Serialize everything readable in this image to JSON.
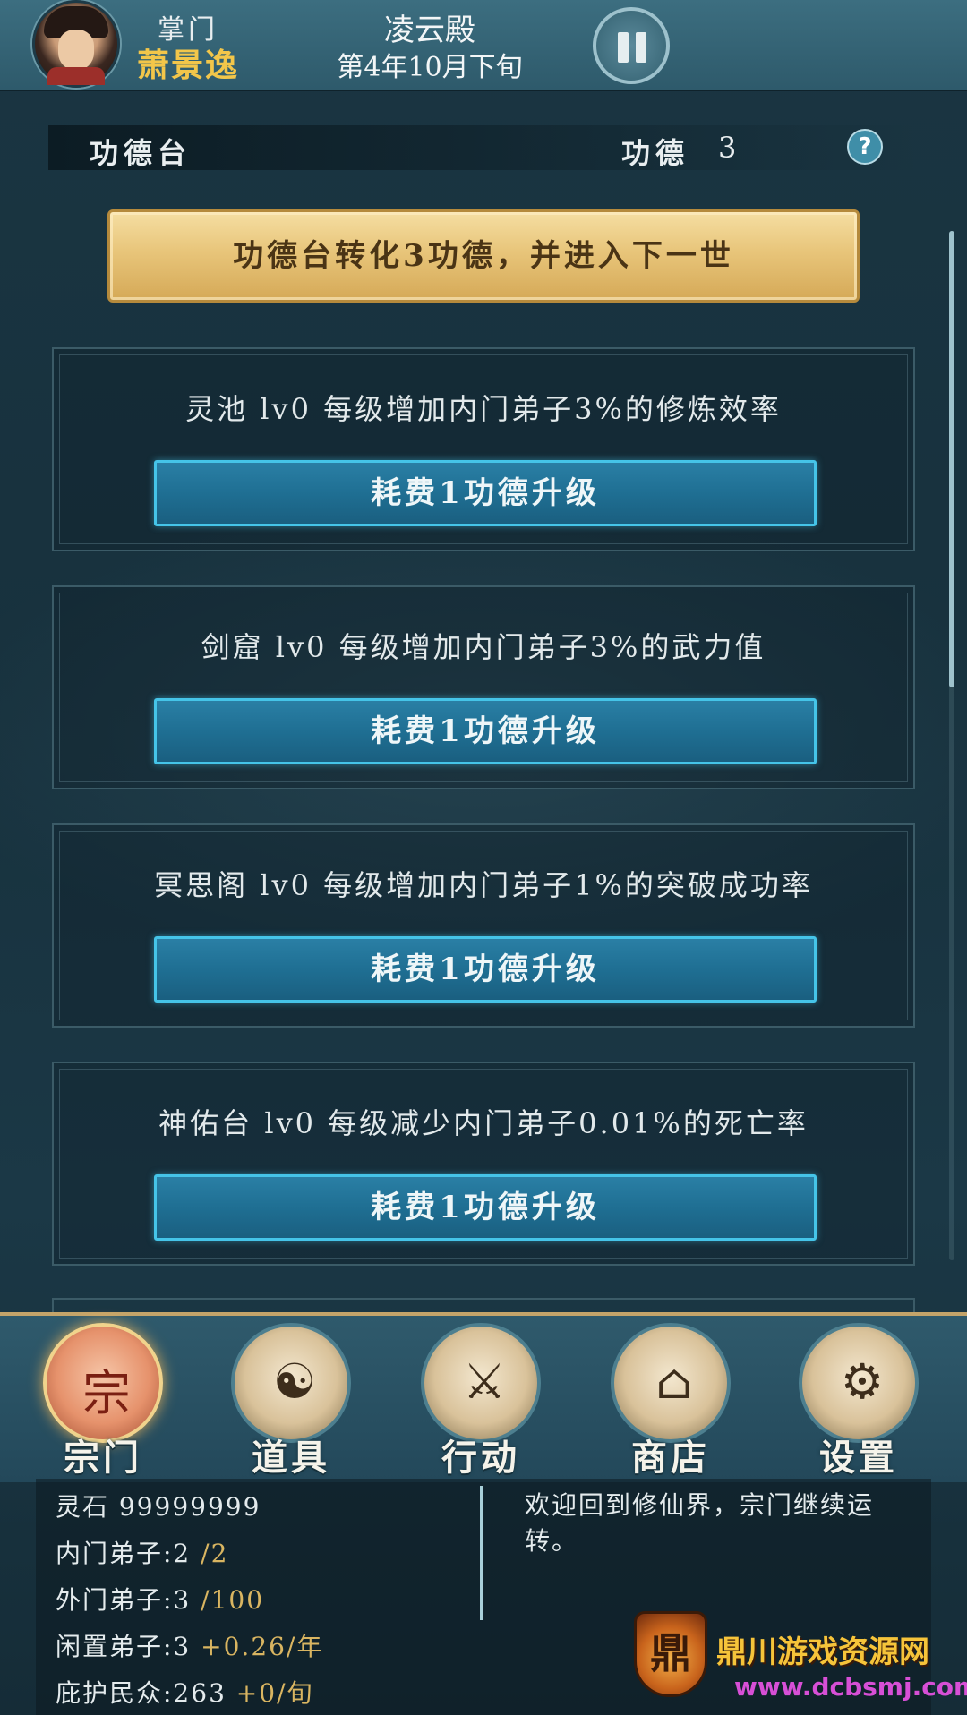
{
  "top_bar": {
    "leader_role": "掌门",
    "leader_name": "萧景逸",
    "sect_name": "凌云殿",
    "date": "第4年10月下旬"
  },
  "header": {
    "title": "功德台",
    "merit_label": "功德",
    "merit_value": "3",
    "help_symbol": "?"
  },
  "convert_button": "功德台转化3功德，并进入下一世",
  "upgrades": [
    {
      "description": "灵池 lv0 每级增加内门弟子3%的修炼效率",
      "button": "耗费1功德升级"
    },
    {
      "description": "剑窟 lv0 每级增加内门弟子3%的武力值",
      "button": "耗费1功德升级"
    },
    {
      "description": "冥思阁 lv0 每级增加内门弟子1%的突破成功率",
      "button": "耗费1功德升级"
    },
    {
      "description": "神佑台 lv0 每级减少内门弟子0.01%的死亡率",
      "button": "耗费1功德升级"
    }
  ],
  "nav": [
    {
      "label": "宗门",
      "icon": "sect-gate-icon",
      "glyph": "宗",
      "active": true
    },
    {
      "label": "道具",
      "icon": "item-bag-icon",
      "glyph": "☯",
      "active": false
    },
    {
      "label": "行动",
      "icon": "action-sword-icon",
      "glyph": "⚔",
      "active": false
    },
    {
      "label": "商店",
      "icon": "shop-building-icon",
      "glyph": "⌂",
      "active": false
    },
    {
      "label": "设置",
      "icon": "gear-icon",
      "glyph": "⚙",
      "active": false
    }
  ],
  "stats": {
    "spirit_stone": "灵石 99999999",
    "inner_disciples": "内门弟子:2",
    "inner_disciples_max": "/2",
    "outer_disciples": "外门弟子:3",
    "outer_disciples_max": "/100",
    "idle_disciples": "闲置弟子:3",
    "idle_rate": "+0.26/年",
    "protected": "庇护民众:263",
    "protected_rate": "+0/旬"
  },
  "message": "欢迎回到修仙界，宗门继续运转。",
  "watermark": {
    "logo_char": "鼎",
    "title": "鼎川游戏资源网",
    "url": "www.dcbsmj.com"
  },
  "colors": {
    "accent_gold": "#f2c64a",
    "button_blue": "#1f6f93",
    "button_border": "#45c4e8",
    "background": "#16303d"
  }
}
